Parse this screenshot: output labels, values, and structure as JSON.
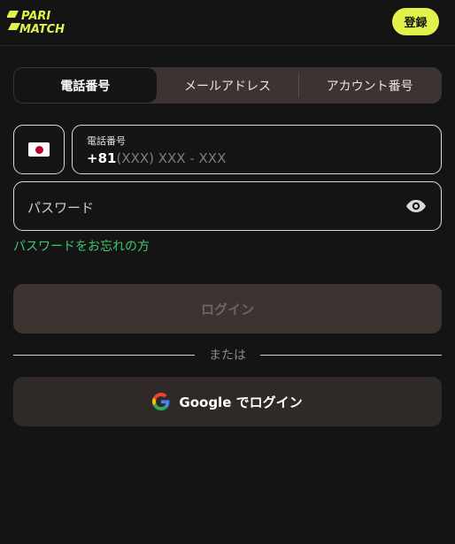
{
  "header": {
    "logo_line1": "PARI",
    "logo_line2": "MATCH",
    "register_label": "登録"
  },
  "tabs": [
    {
      "label": "電話番号",
      "active": true
    },
    {
      "label": "メールアドレス",
      "active": false
    },
    {
      "label": "アカウント番号",
      "active": false
    }
  ],
  "phone": {
    "label": "電話番号",
    "country_code": "+81",
    "placeholder": "(XXX) XXX - XXX"
  },
  "password": {
    "placeholder": "パスワード"
  },
  "forgot_password": "パスワードをお忘れの方",
  "login_label": "ログイン",
  "divider_text": "または",
  "google_login_label": "Google でログイン",
  "colors": {
    "accent": "#e3f24a",
    "link": "#3ec773",
    "background": "#141414",
    "button": "#3b3431"
  }
}
